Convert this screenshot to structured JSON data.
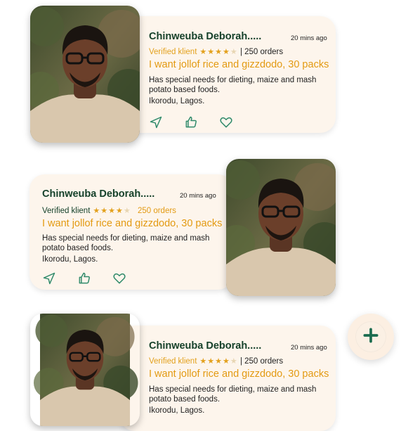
{
  "posts": [
    {
      "name": "Chinweuba Deborah.....",
      "time": "20 mins ago",
      "verified": "Verified klient",
      "stars": "★★★★",
      "stars_empty": "★",
      "orders": "| 250 orders",
      "request": "I want jollof rice and gizzdodo, 30 packs",
      "description": "Has special needs for dieting, maize and mash potato based foods.",
      "location": "Ikorodu, Lagos."
    },
    {
      "name": "Chinweuba Deborah.....",
      "time": "20 mins ago",
      "verified": "Verified klient",
      "stars": "★★★★",
      "stars_empty": "★",
      "orders": "250 orders",
      "request": "I want jollof rice and gizzdodo, 30 packs",
      "description": "Has special needs for dieting, maize and mash potato based foods.",
      "location": "Ikorodu, Lagos."
    },
    {
      "name": "Chinweuba Deborah.....",
      "time": "20 mins ago",
      "verified": "Verified klient",
      "stars": "★★★★",
      "stars_empty": "★",
      "orders": "| 250 orders",
      "request": "I want jollof rice and gizzdodo, 30 packs",
      "description": "Has special needs for dieting, maize and mash potato based foods.",
      "location": "Ikorodu, Lagos."
    }
  ],
  "icons": {
    "send": "send-icon",
    "like": "thumbs-up-icon",
    "favorite": "heart-icon",
    "add": "plus-icon"
  },
  "colors": {
    "card_bg": "#fdf5ec",
    "name": "#15412a",
    "accent": "#e39a12",
    "icon": "#2f8a6a",
    "fab_plus": "#1a6b4e"
  }
}
